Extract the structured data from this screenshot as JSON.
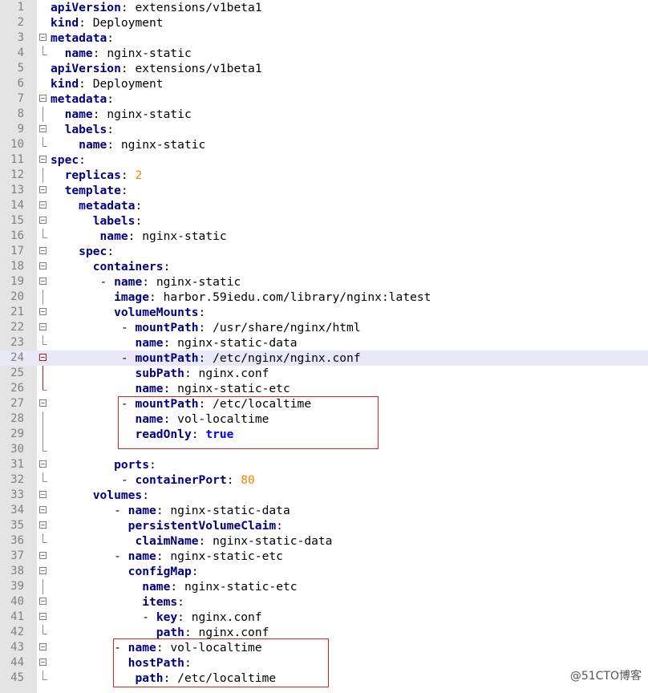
{
  "editor": {
    "lines": [
      {
        "n": "1",
        "indent": 0,
        "key": "apiVersion",
        "sep": ": ",
        "val": "extensions/v1beta1",
        "vtype": "str",
        "fold": ""
      },
      {
        "n": "2",
        "indent": 0,
        "key": "kind",
        "sep": ": ",
        "val": "Deployment",
        "vtype": "str",
        "fold": ""
      },
      {
        "n": "3",
        "indent": 0,
        "key": "metadata",
        "sep": ":",
        "val": "",
        "vtype": "str",
        "fold": "open"
      },
      {
        "n": "4",
        "indent": 2,
        "key": "name",
        "sep": ": ",
        "val": "nginx-static",
        "vtype": "str",
        "fold": "end"
      },
      {
        "n": "5",
        "indent": 0,
        "key": "apiVersion",
        "sep": ": ",
        "val": "extensions/v1beta1",
        "vtype": "str",
        "fold": ""
      },
      {
        "n": "6",
        "indent": 0,
        "key": "kind",
        "sep": ": ",
        "val": "Deployment",
        "vtype": "str",
        "fold": ""
      },
      {
        "n": "7",
        "indent": 0,
        "key": "metadata",
        "sep": ":",
        "val": "",
        "vtype": "str",
        "fold": "open"
      },
      {
        "n": "8",
        "indent": 2,
        "key": "name",
        "sep": ": ",
        "val": "nginx-static",
        "vtype": "str",
        "fold": "line"
      },
      {
        "n": "9",
        "indent": 2,
        "key": "labels",
        "sep": ":",
        "val": "",
        "vtype": "str",
        "fold": "open"
      },
      {
        "n": "10",
        "indent": 4,
        "key": "name",
        "sep": ": ",
        "val": "nginx-static",
        "vtype": "str",
        "fold": "end"
      },
      {
        "n": "11",
        "indent": 0,
        "key": "spec",
        "sep": ":",
        "val": "",
        "vtype": "str",
        "fold": "open"
      },
      {
        "n": "12",
        "indent": 2,
        "key": "replicas",
        "sep": ": ",
        "val": "2",
        "vtype": "num",
        "fold": "line"
      },
      {
        "n": "13",
        "indent": 2,
        "key": "template",
        "sep": ":",
        "val": "",
        "vtype": "str",
        "fold": "open"
      },
      {
        "n": "14",
        "indent": 4,
        "key": "metadata",
        "sep": ":",
        "val": "",
        "vtype": "str",
        "fold": "open"
      },
      {
        "n": "15",
        "indent": 6,
        "key": "labels",
        "sep": ":",
        "val": "",
        "vtype": "str",
        "fold": "open"
      },
      {
        "n": "16",
        "indent": 7,
        "key": "name",
        "sep": ": ",
        "val": "nginx-static",
        "vtype": "str",
        "fold": "end"
      },
      {
        "n": "17",
        "indent": 4,
        "key": "spec",
        "sep": ":",
        "val": "",
        "vtype": "str",
        "fold": "open"
      },
      {
        "n": "18",
        "indent": 6,
        "key": "containers",
        "sep": ":",
        "val": "",
        "vtype": "str",
        "fold": "open"
      },
      {
        "n": "19",
        "indent": 7,
        "key": "- name",
        "sep": ": ",
        "val": "nginx-static",
        "vtype": "str",
        "fold": "open"
      },
      {
        "n": "20",
        "indent": 9,
        "key": "image",
        "sep": ": ",
        "val": "harbor.59iedu.com/library/nginx:latest",
        "vtype": "str",
        "fold": "line"
      },
      {
        "n": "21",
        "indent": 9,
        "key": "volumeMounts",
        "sep": ":",
        "val": "",
        "vtype": "str",
        "fold": "open"
      },
      {
        "n": "22",
        "indent": 10,
        "key": "- mountPath",
        "sep": ": ",
        "val": "/usr/share/nginx/html",
        "vtype": "str",
        "fold": "open"
      },
      {
        "n": "23",
        "indent": 12,
        "key": "name",
        "sep": ": ",
        "val": "nginx-static-data",
        "vtype": "str",
        "fold": "end"
      },
      {
        "n": "24",
        "indent": 10,
        "key": "- mountPath",
        "sep": ": ",
        "val": "/etc/nginx/nginx.conf",
        "vtype": "str",
        "fold": "openred",
        "hl": true
      },
      {
        "n": "25",
        "indent": 12,
        "key": "subPath",
        "sep": ": ",
        "val": "nginx.conf",
        "vtype": "str",
        "fold": "linered"
      },
      {
        "n": "26",
        "indent": 12,
        "key": "name",
        "sep": ": ",
        "val": "nginx-static-etc",
        "vtype": "str",
        "fold": "endred"
      },
      {
        "n": "27",
        "indent": 10,
        "key": "- mountPath",
        "sep": ": ",
        "val": "/etc/localtime",
        "vtype": "str",
        "fold": "open"
      },
      {
        "n": "28",
        "indent": 12,
        "key": "name",
        "sep": ": ",
        "val": "vol-localtime",
        "vtype": "str",
        "fold": "line"
      },
      {
        "n": "29",
        "indent": 12,
        "key": "readOnly",
        "sep": ": ",
        "val": "true",
        "vtype": "kw",
        "fold": "line"
      },
      {
        "n": "30",
        "indent": 0,
        "key": "",
        "sep": "",
        "val": "",
        "vtype": "str",
        "fold": "end"
      },
      {
        "n": "31",
        "indent": 9,
        "key": "ports",
        "sep": ":",
        "val": "",
        "vtype": "str",
        "fold": "open"
      },
      {
        "n": "32",
        "indent": 10,
        "key": "- containerPort",
        "sep": ": ",
        "val": "80",
        "vtype": "num",
        "fold": "end"
      },
      {
        "n": "33",
        "indent": 6,
        "key": "volumes",
        "sep": ":",
        "val": "",
        "vtype": "str",
        "fold": "open"
      },
      {
        "n": "34",
        "indent": 9,
        "key": "- name",
        "sep": ": ",
        "val": "nginx-static-data",
        "vtype": "str",
        "fold": "open"
      },
      {
        "n": "35",
        "indent": 11,
        "key": "persistentVolumeClaim",
        "sep": ":",
        "val": "",
        "vtype": "str",
        "fold": "open"
      },
      {
        "n": "36",
        "indent": 12,
        "key": "claimName",
        "sep": ": ",
        "val": "nginx-static-data",
        "vtype": "str",
        "fold": "end"
      },
      {
        "n": "37",
        "indent": 9,
        "key": "- name",
        "sep": ": ",
        "val": "nginx-static-etc",
        "vtype": "str",
        "fold": "open"
      },
      {
        "n": "38",
        "indent": 11,
        "key": "configMap",
        "sep": ":",
        "val": "",
        "vtype": "str",
        "fold": "open"
      },
      {
        "n": "39",
        "indent": 13,
        "key": "name",
        "sep": ": ",
        "val": "nginx-static-etc",
        "vtype": "str",
        "fold": "line"
      },
      {
        "n": "40",
        "indent": 13,
        "key": "items",
        "sep": ":",
        "val": "",
        "vtype": "str",
        "fold": "open"
      },
      {
        "n": "41",
        "indent": 13,
        "key": "- key",
        "sep": ": ",
        "val": "nginx.conf",
        "vtype": "str",
        "fold": "open"
      },
      {
        "n": "42",
        "indent": 15,
        "key": "path",
        "sep": ": ",
        "val": "nginx.conf",
        "vtype": "str",
        "fold": "end"
      },
      {
        "n": "43",
        "indent": 9,
        "key": "- name",
        "sep": ": ",
        "val": "vol-localtime",
        "vtype": "str",
        "fold": "open"
      },
      {
        "n": "44",
        "indent": 11,
        "key": "hostPath",
        "sep": ":",
        "val": "",
        "vtype": "str",
        "fold": "open"
      },
      {
        "n": "45",
        "indent": 12,
        "key": "path",
        "sep": ": ",
        "val": "/etc/localtime",
        "vtype": "str",
        "fold": "end"
      }
    ]
  },
  "watermark": "@51CTO博客",
  "colors": {
    "key": "#000080",
    "number": "#ff8000",
    "keyword": "#0000ff",
    "highlight": "#e8e8f8",
    "annotation_box": "#dd2222"
  }
}
